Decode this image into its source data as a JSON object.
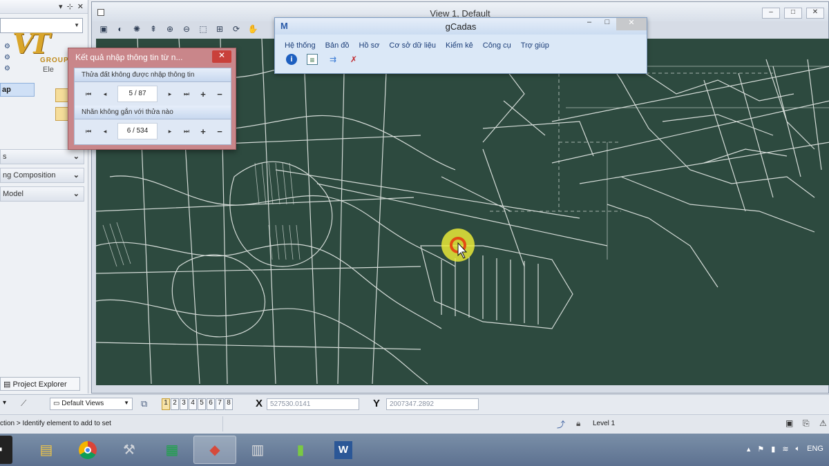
{
  "logo": {
    "mark": "VT",
    "text": "GROUP"
  },
  "left_dock": {
    "el_label": "Ele",
    "selected_item": "ap",
    "panels": [
      "s",
      "ng Composition",
      "Model"
    ],
    "project_tab": "Project Explorer"
  },
  "view": {
    "title": "View 1, Default"
  },
  "gcadas": {
    "title": "gCadas",
    "menu": [
      "Hệ thống",
      "Bản đồ",
      "Hồ sơ",
      "Cơ sở dữ liệu",
      "Kiểm kê",
      "Công cụ",
      "Trợ giúp"
    ],
    "icons": [
      "info-icon",
      "form-icon",
      "link-icon",
      "tools-icon"
    ]
  },
  "dialog": {
    "title": "Kết quả nhập thông tin từ n...",
    "group1": {
      "label": "Thửa đất không được nhập thông tin",
      "counter": "5 / 87"
    },
    "group2": {
      "label": "Nhãn không gắn với thửa nào",
      "counter": "6 / 534"
    },
    "nav": {
      "first": "⏮",
      "prev": "◂",
      "next": "▸",
      "last": "⏭",
      "add": "+",
      "remove": "−"
    }
  },
  "bottom_bar": {
    "views_combo": "Default Views",
    "view_buttons": [
      "1",
      "2",
      "3",
      "4",
      "5",
      "6",
      "7",
      "8"
    ],
    "x_label": "X",
    "x_value": "527530.0141",
    "y_label": "Y",
    "y_value": "2007347.2892"
  },
  "status_bar": {
    "message": "ction > Identify element to add to set",
    "level": "Level 1"
  },
  "tray": {
    "language": "ENG"
  }
}
